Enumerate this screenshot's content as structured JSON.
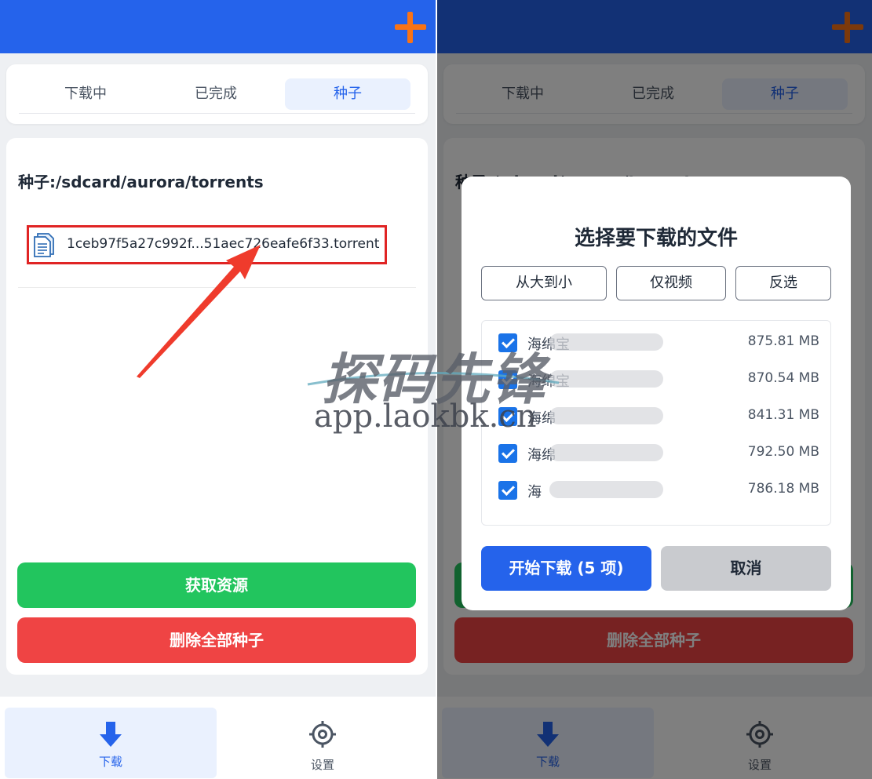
{
  "left": {
    "tabs": [
      {
        "label": "下载中",
        "active": false
      },
      {
        "label": "已完成",
        "active": false
      },
      {
        "label": "种子",
        "active": true
      }
    ],
    "path_label": "种子:/sdcard/aurora/torrents",
    "torrent_file": "1ceb97f5a27c992f...51aec726eafe6f33.torrent",
    "get_resource_button": "获取资源",
    "delete_all_button": "删除全部种子",
    "nav": [
      {
        "label": "下载",
        "icon": "download-arrow-icon",
        "active": true
      },
      {
        "label": "设置",
        "icon": "gear-icon",
        "active": false
      }
    ]
  },
  "right": {
    "tabs": [
      {
        "label": "下载中"
      },
      {
        "label": "已完成"
      },
      {
        "label": "种子"
      }
    ],
    "path_label": "种子:/sdcard/aurora/torrents",
    "delete_all_button": "删除全部种子",
    "nav": [
      {
        "label": "下载"
      },
      {
        "label": "设置"
      }
    ],
    "dialog": {
      "title": "选择要下载的文件",
      "filters": [
        "从大到小",
        "仅视频",
        "反选"
      ],
      "files": [
        {
          "name": "海绵宝",
          "size": "875.81 MB",
          "checked": true
        },
        {
          "name": "海绵宝",
          "size": "870.54 MB",
          "checked": true
        },
        {
          "name": "海绵",
          "size": "841.31 MB",
          "checked": true
        },
        {
          "name": "海绵",
          "size": "792.50 MB",
          "checked": true
        },
        {
          "name": "海",
          "size": "786.18 MB",
          "checked": true
        }
      ],
      "start_button": "开始下载 (5 项)",
      "cancel_button": "取消"
    }
  },
  "watermark": {
    "brand": "探码先锋",
    "site": "app.laokbk.cn"
  },
  "colors": {
    "primary": "#2563eb",
    "accent_plus": "#f97316",
    "success": "#22c55e",
    "danger": "#ef4444",
    "highlight_box": "#e02424"
  }
}
